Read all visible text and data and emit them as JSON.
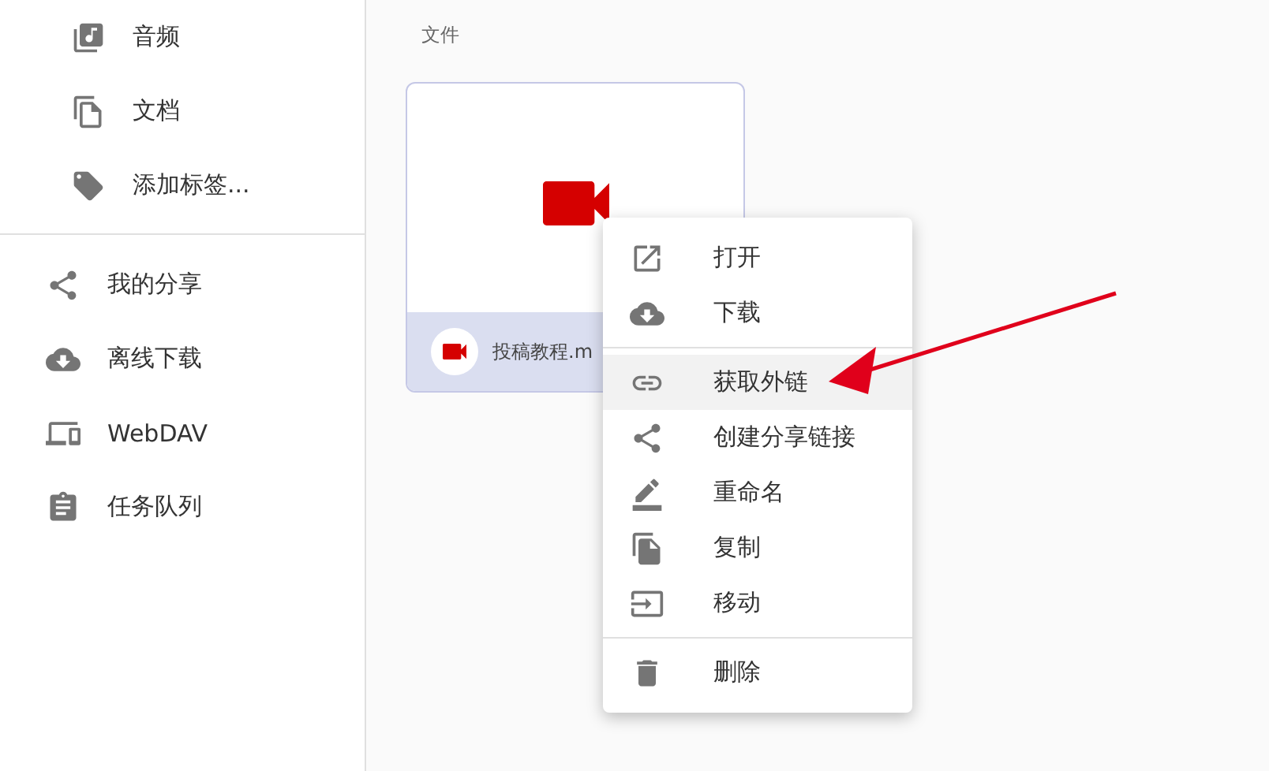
{
  "sidebar": {
    "sub_items": [
      {
        "kind": "music",
        "label": "音频"
      },
      {
        "kind": "docs",
        "label": "文档"
      },
      {
        "kind": "tag",
        "label": "添加标签..."
      }
    ],
    "items": [
      {
        "kind": "share",
        "label": "我的分享"
      },
      {
        "kind": "cloud",
        "label": "离线下载"
      },
      {
        "kind": "devices",
        "label": "WebDAV"
      },
      {
        "kind": "clipboard",
        "label": "任务队列"
      }
    ]
  },
  "section_label": "文件",
  "file_card": {
    "name": "投稿教程.m",
    "selected": true
  },
  "context_menu": {
    "groups": [
      [
        {
          "kind": "open",
          "label": "打开",
          "selected": false
        },
        {
          "kind": "cloud",
          "label": "下载",
          "selected": false
        }
      ],
      [
        {
          "kind": "link",
          "label": "获取外链",
          "selected": true
        },
        {
          "kind": "share",
          "label": "创建分享链接",
          "selected": false
        },
        {
          "kind": "rename",
          "label": "重命名",
          "selected": false
        },
        {
          "kind": "copy",
          "label": "复制",
          "selected": false
        },
        {
          "kind": "move",
          "label": "移动",
          "selected": false
        }
      ],
      [
        {
          "kind": "delete",
          "label": "删除",
          "selected": false
        }
      ]
    ]
  }
}
